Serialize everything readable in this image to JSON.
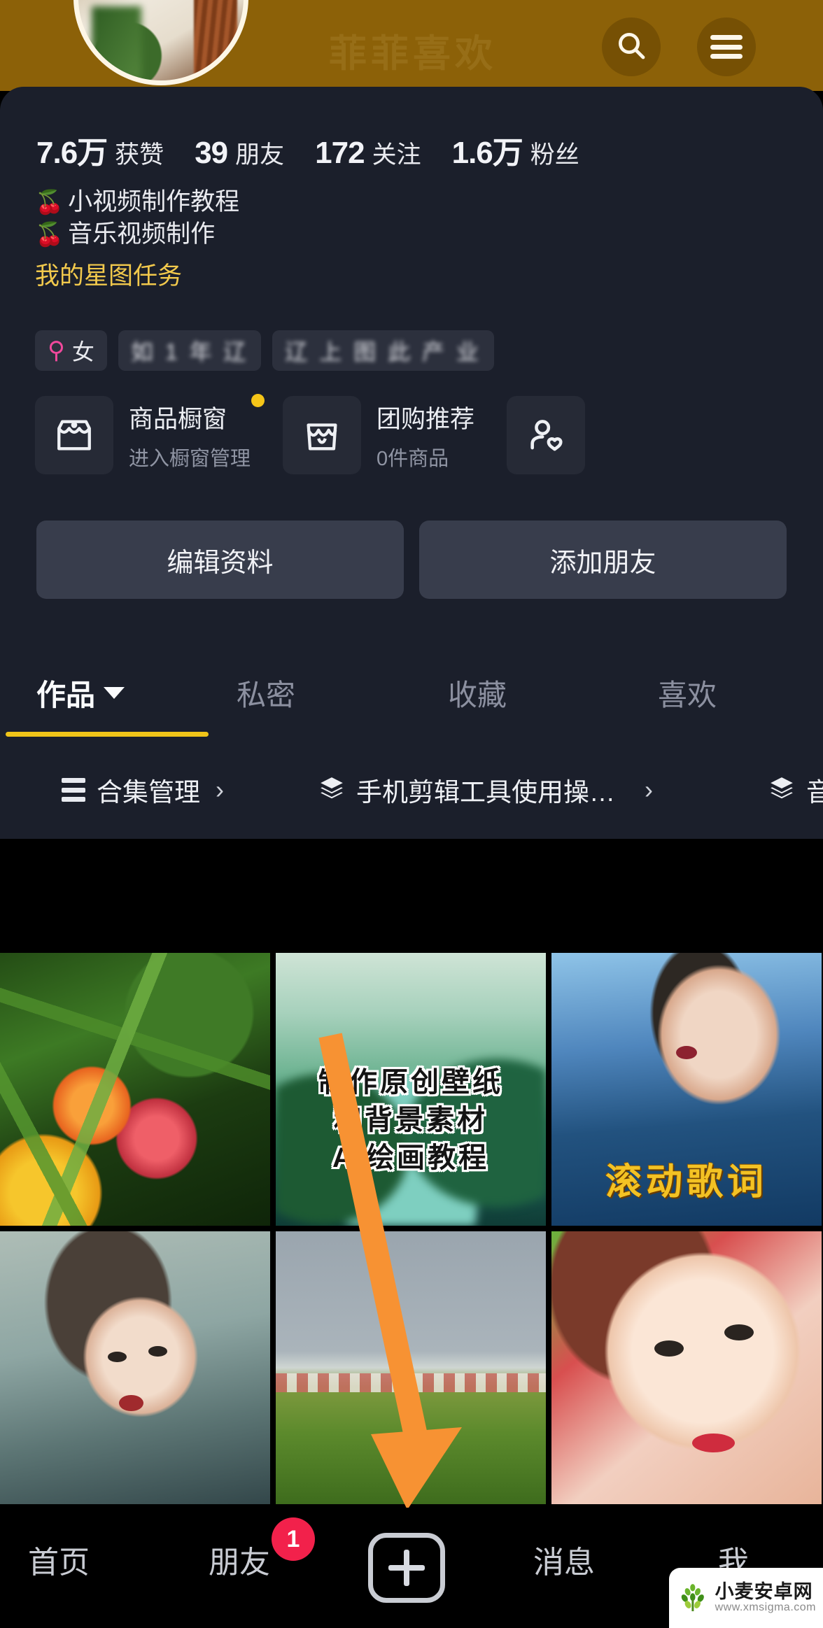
{
  "banner": {
    "background_color": "#8c6108",
    "watermark_text": "菲菲喜欢",
    "search_icon": "search-icon",
    "menu_icon": "hamburger-menu-icon"
  },
  "profile": {
    "stats": [
      {
        "num": "7.6万",
        "label": "获赞"
      },
      {
        "num": "39",
        "label": "朋友"
      },
      {
        "num": "172",
        "label": "关注"
      },
      {
        "num": "1.6万",
        "label": "粉丝"
      }
    ],
    "bio_lines": [
      {
        "emoji": "🍒",
        "text": "小视频制作教程"
      },
      {
        "emoji": "🍒",
        "text": "音乐视频制作"
      }
    ],
    "bio_link": "我的星图任务",
    "chips": [
      {
        "icon": "female-gender-icon",
        "text": "女",
        "blurred": false
      },
      {
        "icon": "",
        "text": "如 1 年 辽",
        "blurred": true
      },
      {
        "icon": "",
        "text": "辽 上 图 此 产 业",
        "blurred": true
      }
    ],
    "showcase": [
      {
        "icon": "storefront-icon",
        "title": "商品橱窗",
        "subtitle": "进入橱窗管理",
        "has_badge": true,
        "badge_color": "#f5c518"
      },
      {
        "icon": "group-buy-icon",
        "title": "团购推荐",
        "subtitle": "0件商品",
        "has_badge": false
      },
      {
        "icon": "person-heart-icon",
        "title": "",
        "subtitle": "",
        "has_badge": false
      }
    ],
    "actions": [
      {
        "label": "编辑资料"
      },
      {
        "label": "添加朋友"
      }
    ]
  },
  "tabs": {
    "active_index": 0,
    "accent_color": "#f0c419",
    "items": [
      {
        "label": "作品",
        "has_caret": true
      },
      {
        "label": "私密",
        "has_caret": false
      },
      {
        "label": "收藏",
        "has_caret": false
      },
      {
        "label": "喜欢",
        "has_caret": false
      }
    ]
  },
  "collections": [
    {
      "icon": "list-icon",
      "label": "合集管理",
      "chevron": "›"
    },
    {
      "icon": "layers-icon",
      "label": "手机剪辑工具使用操…",
      "chevron": "›"
    },
    {
      "icon": "layers-icon",
      "label": "音",
      "chevron": ""
    }
  ],
  "grid": [
    {
      "thumb": "t-peach",
      "overlay_lines": []
    },
    {
      "thumb": "t-land",
      "overlay_lines": [
        "制作原创壁纸",
        "和背景素材",
        "AI绘画教程"
      ],
      "overlay_style": "black-on-white"
    },
    {
      "thumb": "t-woman-blue",
      "overlay_lines": [
        "滚动歌词"
      ],
      "overlay_style": "gold"
    },
    {
      "thumb": "t-woman-grey",
      "overlay_lines": []
    },
    {
      "thumb": "t-field",
      "overlay_lines": []
    },
    {
      "thumb": "t-woman-closeup",
      "overlay_lines": []
    }
  ],
  "annotation": {
    "type": "arrow",
    "color": "#f79233",
    "points_to": "create-post-button"
  },
  "bottom_nav": {
    "items": [
      {
        "label": "首页",
        "badge": ""
      },
      {
        "label": "朋友",
        "badge": "1"
      },
      {
        "label": "消息",
        "badge": ""
      },
      {
        "label": "我",
        "badge": ""
      }
    ],
    "create_button_icon": "plus-icon",
    "badge_color": "#f2214b"
  },
  "watermark": {
    "name": "小麦安卓网",
    "url": "www.xmsigma.com",
    "logo": "wheat-logo-icon"
  }
}
